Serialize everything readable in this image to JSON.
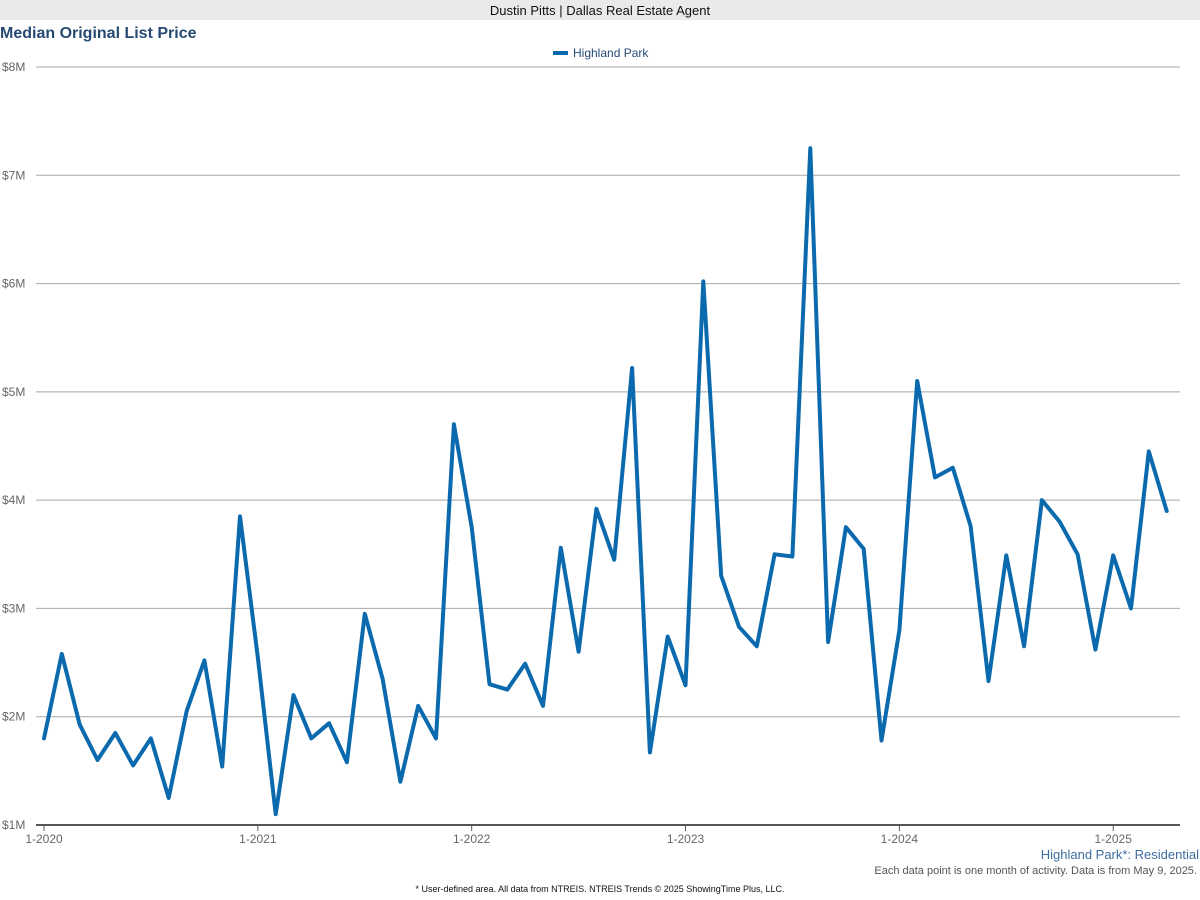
{
  "header": {
    "agent": "Dustin Pitts | Dallas Real Estate Agent"
  },
  "chart_data": {
    "type": "line",
    "title": "Median Original List Price",
    "xlabel": "",
    "ylabel": "",
    "ylim": [
      1000000,
      8000000
    ],
    "yticks": [
      1000000,
      2000000,
      3000000,
      4000000,
      5000000,
      6000000,
      7000000,
      8000000
    ],
    "ytick_labels": [
      "$1M",
      "$2M",
      "$3M",
      "$4M",
      "$5M",
      "$6M",
      "$7M",
      "$8M"
    ],
    "xtick_labels": [
      "1-2020",
      "1-2021",
      "1-2022",
      "1-2023",
      "1-2024",
      "1-2025"
    ],
    "x_start": "2020-01",
    "x_end": "2025-04",
    "grid": true,
    "legend_position": "top-center",
    "series": [
      {
        "name": "Highland Park",
        "color": "#0b6aae",
        "values": [
          1800000,
          2580000,
          1930000,
          1600000,
          1850000,
          1550000,
          1800000,
          1250000,
          2050000,
          2520000,
          1540000,
          3850000,
          2550000,
          1100000,
          2200000,
          1800000,
          1940000,
          1580000,
          2950000,
          2350000,
          1400000,
          2100000,
          1800000,
          4700000,
          3750000,
          2300000,
          2250000,
          2490000,
          2100000,
          3560000,
          2600000,
          3920000,
          3450000,
          5220000,
          1670000,
          2740000,
          2290000,
          6020000,
          3300000,
          2830000,
          2650000,
          3500000,
          3480000,
          7250000,
          2690000,
          3750000,
          3550000,
          1780000,
          2800000,
          5100000,
          4210000,
          4300000,
          3760000,
          2330000,
          3490000,
          2650000,
          4000000,
          3800000,
          3500000,
          2620000,
          3490000,
          3000000,
          4450000,
          3900000
        ]
      }
    ]
  },
  "footer": {
    "area_label": "Highland Park*: Residential",
    "note": "Each data point is one month of activity. Data is from May 9, 2025.",
    "disclaimer": "* User-defined area. All data from NTREIS. NTREIS Trends © 2025 ShowingTime Plus, LLC."
  }
}
